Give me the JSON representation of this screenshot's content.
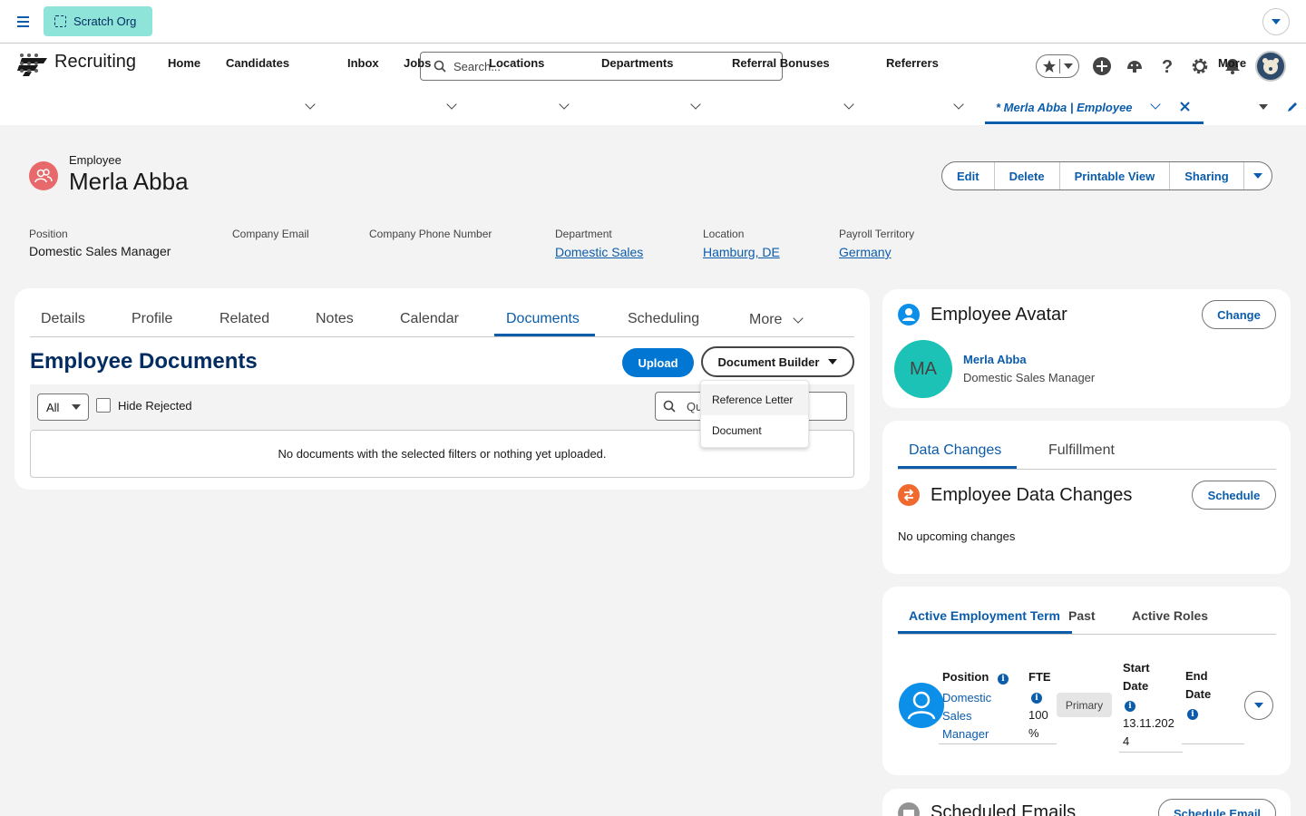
{
  "org": {
    "label": "Scratch Org"
  },
  "search": {
    "placeholder": "Search..."
  },
  "app": {
    "name": "Recruiting"
  },
  "nav": {
    "items": [
      "Home",
      "Candidates",
      "Inbox",
      "Jobs",
      "Locations",
      "Departments",
      "Referral Bonuses",
      "Referrers"
    ],
    "active_tab": "* Merla Abba | Employee",
    "more": "More"
  },
  "record": {
    "type": "Employee",
    "name": "Merla Abba",
    "actions": [
      "Edit",
      "Delete",
      "Printable View",
      "Sharing"
    ],
    "fields": [
      {
        "label": "Position",
        "value": "Domestic Sales Manager"
      },
      {
        "label": "Company Email",
        "value": ""
      },
      {
        "label": "Company Phone Number",
        "value": ""
      },
      {
        "label": "Department",
        "value": "Domestic Sales"
      },
      {
        "label": "Location",
        "value": "Hamburg, DE"
      },
      {
        "label": "Payroll Territory",
        "value": "Germany"
      }
    ]
  },
  "main": {
    "tabs": [
      "Details",
      "Profile",
      "Related",
      "Notes",
      "Calendar",
      "Documents",
      "Scheduling",
      "More"
    ],
    "active_tab": "Documents",
    "title": "Employee Documents",
    "upload": "Upload",
    "document_builder": "Document Builder",
    "filter_select": "All",
    "hide_rejected": "Hide Rejected",
    "search_placeholder": "Qu",
    "empty": "No documents with the selected filters or nothing yet uploaded.",
    "menu": [
      "Reference Letter",
      "Document"
    ]
  },
  "avatar_card": {
    "title": "Employee Avatar",
    "button": "Change",
    "initials": "MA",
    "name": "Merla Abba",
    "position": "Domestic Sales Manager"
  },
  "changes_card": {
    "tabs": [
      "Data Changes",
      "Fulfillment"
    ],
    "title": "Employee Data Changes",
    "button": "Schedule",
    "empty": "No upcoming changes"
  },
  "employment_card": {
    "tabs": [
      "Active Employment Term",
      "Past",
      "Active Roles"
    ],
    "position_label": "Position",
    "position_value": [
      "Domestic",
      "Sales",
      "Manager"
    ],
    "fte_label": "FTE",
    "fte_value": [
      "100",
      "%"
    ],
    "primary": "Primary",
    "start_label": [
      "Start",
      "Date"
    ],
    "start_value": [
      "13.11.202",
      "4"
    ],
    "end_label": [
      "End",
      "Date"
    ]
  },
  "emails_card": {
    "title": "Scheduled Emails",
    "button": "Schedule Email"
  }
}
